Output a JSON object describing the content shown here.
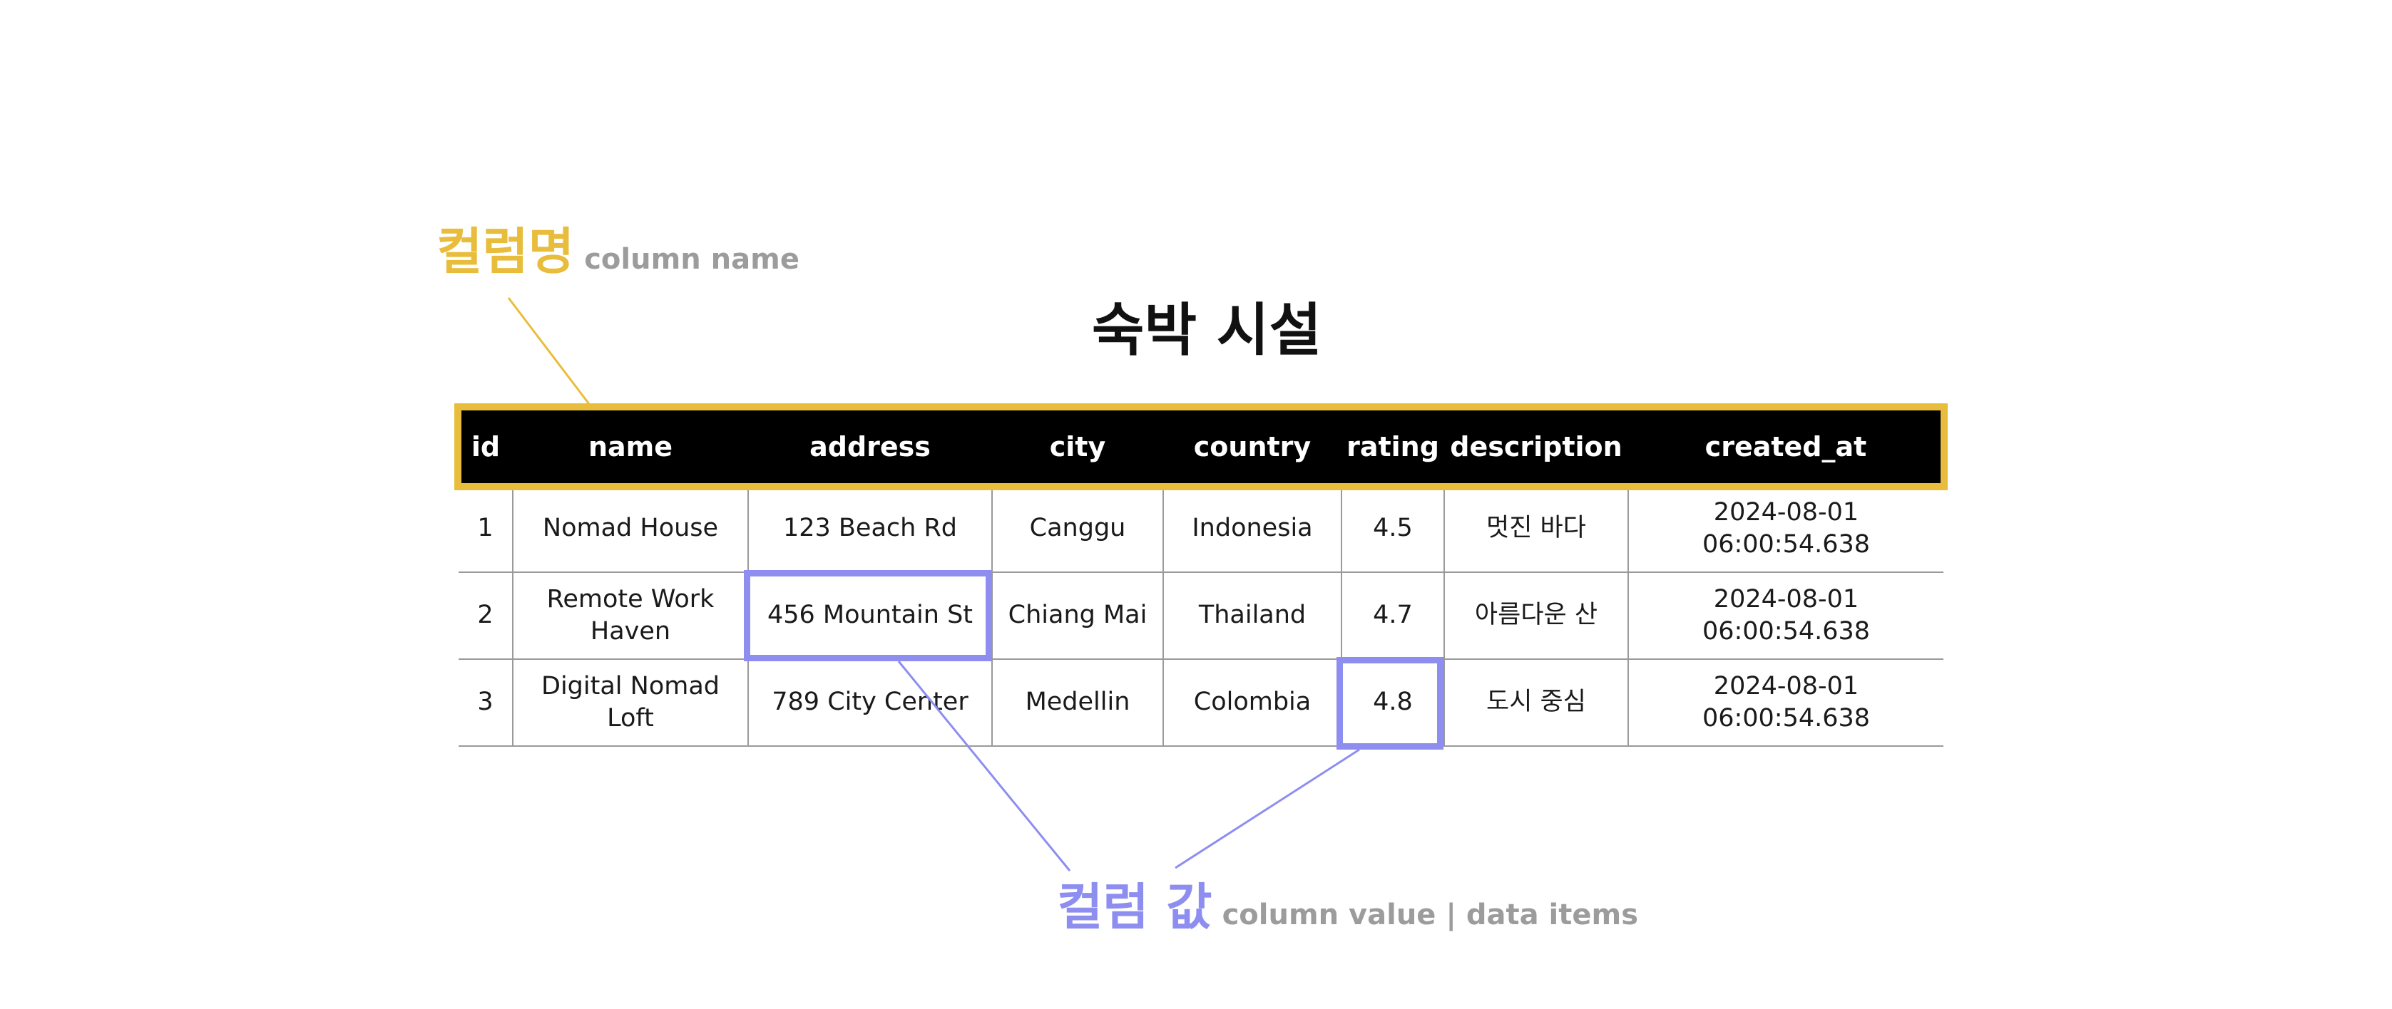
{
  "labels": {
    "column_name": {
      "korean": "컬럼명",
      "english": "column name"
    },
    "column_value": {
      "korean": "컬럼 값",
      "english": "column value | data items"
    }
  },
  "table": {
    "title": "숙박 시설",
    "columns": [
      "id",
      "name",
      "address",
      "city",
      "country",
      "rating",
      "description",
      "created_at"
    ],
    "rows": [
      [
        "1",
        "Nomad House",
        "123 Beach Rd",
        "Canggu",
        "Indonesia",
        "4.5",
        "멋진 바다",
        "2024-08-01 06:00:54.638"
      ],
      [
        "2",
        "Remote Work Haven",
        "456 Mountain St",
        "Chiang Mai",
        "Thailand",
        "4.7",
        "아름다운 산",
        "2024-08-01 06:00:54.638"
      ],
      [
        "3",
        "Digital Nomad Loft",
        "789 City Center",
        "Medellin",
        "Colombia",
        "4.8",
        "도시 중심",
        "2024-08-01 06:00:54.638"
      ]
    ]
  },
  "colors": {
    "column_name_accent": "#e9bd3c",
    "column_value_accent": "#8d8ef0",
    "header_background": "#000000",
    "header_text": "#ffffff"
  }
}
